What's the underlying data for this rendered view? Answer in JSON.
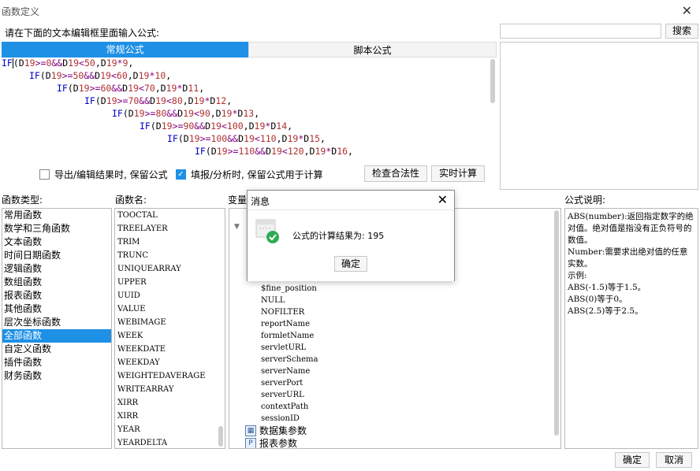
{
  "window": {
    "title": "函数定义",
    "close_glyph": "✕"
  },
  "editor": {
    "hint": "请在下面的文本编辑框里面输入公式:",
    "tabs": [
      "常规公式",
      "脚本公式"
    ],
    "lines": [
      {
        "indent": 0,
        "text": "IF(D19>=0&&D19<50,D19*I9,"
      },
      {
        "indent": 5,
        "text": "IF(D19>=50&&D19<60,D19*I10,"
      },
      {
        "indent": 10,
        "text": "IF(D19>=60&&D19<70,D19*D11,"
      },
      {
        "indent": 15,
        "text": "IF(D19>=70&&D19<80,D19*D12,"
      },
      {
        "indent": 20,
        "text": "IF(D19>=80&&D19<90,D19*D13,"
      },
      {
        "indent": 25,
        "text": "IF(D19>=90&&D19<100,D19*D14,"
      },
      {
        "indent": 30,
        "text": "IF(D19>=100&&D19<110,D19*D15,"
      },
      {
        "indent": 35,
        "text": "IF(D19>=110&&D19<120,D19*D16,"
      }
    ]
  },
  "search": {
    "button_label": "搜索",
    "placeholder": ""
  },
  "options": {
    "keep_formula_export": {
      "label": "导出/编辑结果时, 保留公式",
      "checked": false
    },
    "keep_formula_fill": {
      "label": "填报/分析时, 保留公式用于计算",
      "checked": true
    },
    "check_button": "检查合法性",
    "realtime_button": "实时计算"
  },
  "columns": {
    "func_type_label": "函数类型:",
    "func_name_label": "函数名:",
    "var_label": "变量",
    "desc_label": "公式说明:"
  },
  "func_types": [
    "常用函数",
    "数学和三角函数",
    "文本函数",
    "时间日期函数",
    "逻辑函数",
    "数组函数",
    "报表函数",
    "其他函数",
    "层次坐标函数",
    "全部函数",
    "自定义函数",
    "插件函数",
    "财务函数"
  ],
  "func_types_selected": 9,
  "func_names": [
    "TOOCTAL",
    "TREELAYER",
    "TRIM",
    "TRUNC",
    "UNIQUEARRAY",
    "UPPER",
    "UUID",
    "VALUE",
    "WEBIMAGE",
    "WEEK",
    "WEEKDATE",
    "WEEKDAY",
    "WEIGHTEDAVERAGE",
    "WRITEARRAY",
    "XIRR",
    "XIRR",
    "YEAR",
    "YEARDELTA"
  ],
  "variables": [
    "$fine_position",
    "NULL",
    "NOFILTER",
    "reportName",
    "formletName",
    "servletURL",
    "serverSchema",
    "serverName",
    "serverPort",
    "serverURL",
    "contextPath",
    "sessionID"
  ],
  "variable_categories": [
    {
      "icon": "dataset-param-icon",
      "label": "数据集参数"
    },
    {
      "icon": "report-param-icon",
      "label": "报表参数",
      "glyph": "P"
    }
  ],
  "description": [
    "ABS(number):返回指定数字的绝对值。绝对值是指没有正负符号的数值。",
    "Number:需要求出绝对值的任意实数。",
    "示例:",
    "ABS(-1.5)等于1.5。",
    "ABS(0)等于0。",
    "ABS(2.5)等于2.5。"
  ],
  "footer": {
    "ok": "确定",
    "cancel": "取消"
  },
  "dialog": {
    "title": "消息",
    "close_glyph": "✕",
    "message": "公式的计算结果为: 195",
    "ok": "确定",
    "icon": "success-icon"
  },
  "colors": {
    "accent": "#1e90e6",
    "success": "#2eaa55"
  }
}
